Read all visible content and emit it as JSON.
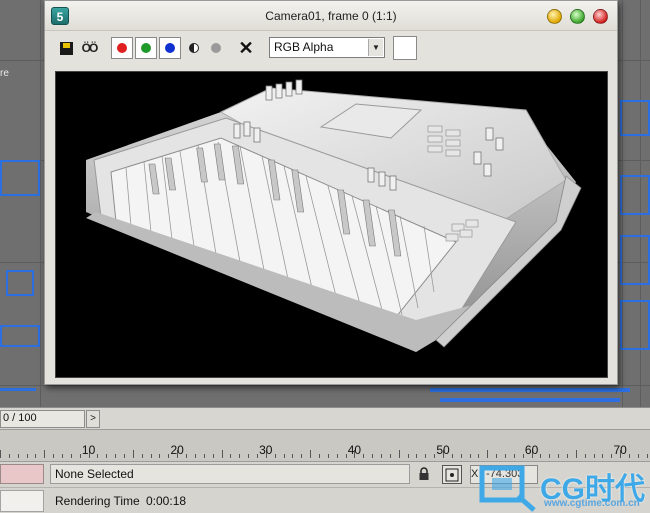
{
  "window": {
    "title": "Camera01, frame 0 (1:1)",
    "app_icon_glyph": "5"
  },
  "toolbar": {
    "channel_selected": "RGB Alpha",
    "red_channel_color": "#e02020",
    "green_channel_color": "#1f9a2a",
    "blue_channel_color": "#1030d0",
    "swatch_color": "#ffffff"
  },
  "background": {
    "label": "re"
  },
  "timeline": {
    "frame_counter": "0 / 100",
    "next_glyph": ">",
    "ruler_labels": [
      "10",
      "20",
      "30",
      "40",
      "50",
      "60",
      "70"
    ]
  },
  "status": {
    "selection": "None Selected",
    "rendering_label": "Rendering Time",
    "rendering_value": "0:00:18",
    "x_label": "X",
    "x_value": "-74.303"
  },
  "watermark": {
    "text": "CG时代",
    "subtext": "www.cgtime.com.cn"
  },
  "icons": [
    "save-icon",
    "clone-icon",
    "red-channel-icon",
    "green-channel-icon",
    "blue-channel-icon",
    "mono-icon",
    "alpha-icon",
    "clear-icon",
    "lock-icon",
    "absolute-mode-icon"
  ]
}
